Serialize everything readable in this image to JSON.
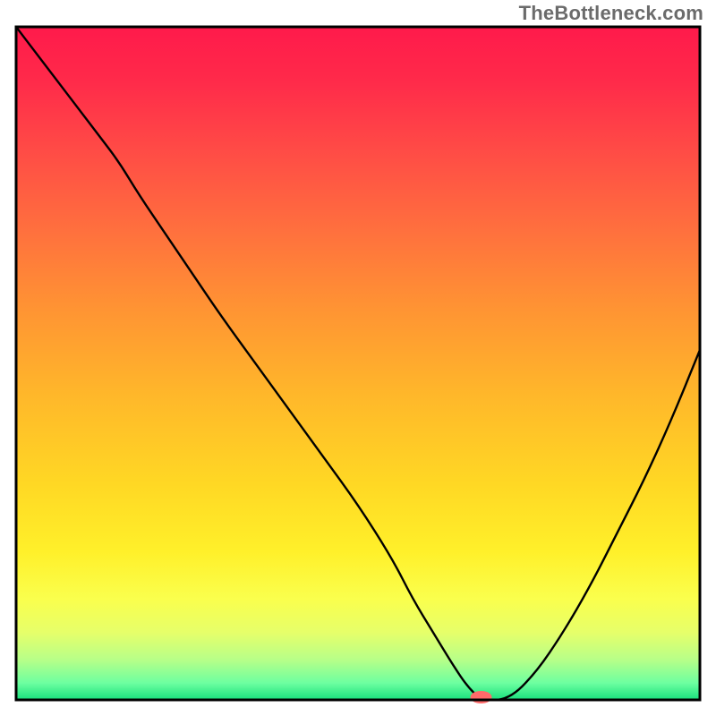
{
  "watermark": "TheBottleneck.com",
  "chart_data": {
    "type": "line",
    "title": "",
    "subtitle": "",
    "xlabel": "",
    "ylabel": "",
    "xlim": [
      0,
      100
    ],
    "ylim": [
      0,
      100
    ],
    "legend": false,
    "background_gradient_stops": [
      {
        "offset": 0.0,
        "color": "#ff1a4b"
      },
      {
        "offset": 0.08,
        "color": "#ff2a4a"
      },
      {
        "offset": 0.18,
        "color": "#ff4a46"
      },
      {
        "offset": 0.3,
        "color": "#ff6f3e"
      },
      {
        "offset": 0.42,
        "color": "#ff9433"
      },
      {
        "offset": 0.55,
        "color": "#ffb82a"
      },
      {
        "offset": 0.68,
        "color": "#ffd824"
      },
      {
        "offset": 0.78,
        "color": "#fff02a"
      },
      {
        "offset": 0.85,
        "color": "#faff4d"
      },
      {
        "offset": 0.9,
        "color": "#e6ff6a"
      },
      {
        "offset": 0.94,
        "color": "#b8ff88"
      },
      {
        "offset": 0.975,
        "color": "#6dffa0"
      },
      {
        "offset": 1.0,
        "color": "#18e07d"
      }
    ],
    "series": [
      {
        "name": "bottleneck-curve",
        "color": "#000000",
        "stroke_width": 2.4,
        "x": [
          0,
          3,
          6,
          9,
          12,
          15,
          18,
          22,
          26,
          30,
          35,
          40,
          45,
          50,
          55,
          58,
          61,
          64,
          66,
          68,
          72,
          76,
          80,
          84,
          88,
          92,
          96,
          100
        ],
        "y": [
          100,
          96,
          92,
          88,
          84,
          80,
          75,
          69,
          63,
          57,
          50,
          43,
          36,
          29,
          21,
          15,
          10,
          5,
          2,
          0,
          0,
          4,
          10,
          17,
          25,
          33,
          42,
          52
        ]
      }
    ],
    "marker": {
      "name": "bottleneck-point",
      "color": "#ff6a6a",
      "x": 68,
      "y": 0,
      "rx": 12,
      "ry": 7
    },
    "frame": {
      "color": "#000000",
      "width": 3
    }
  }
}
